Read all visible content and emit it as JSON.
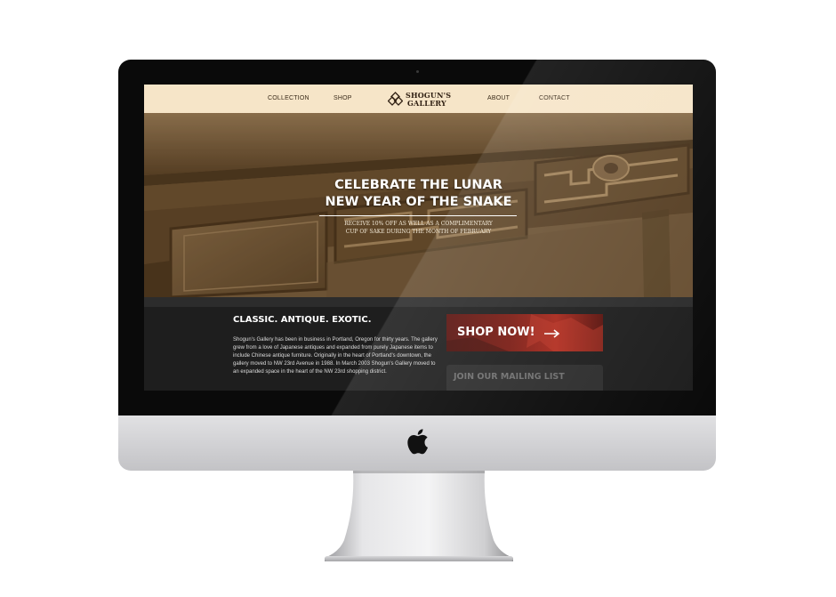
{
  "site": {
    "nav": {
      "left_links": [
        "COLLECTION",
        "SHOP"
      ],
      "right_links": [
        "ABOUT",
        "CONTACT"
      ],
      "brand_line1": "SHOGUN'S",
      "brand_line2": "GALLERY",
      "brand_icon": "diamond-lattice-icon"
    },
    "hero": {
      "title_line1": "CELEBRATE THE LUNAR",
      "title_line2": "NEW YEAR OF THE SNAKE",
      "subtitle_line1": "RECEIVE 10% OFF AS WELL AS A COMPLIMENTARY",
      "subtitle_line2": "CUP OF SAKE DURING THE MONTH OF FEBRUARY"
    },
    "content": {
      "tagline": "CLASSIC. ANTIQUE. EXOTIC.",
      "about": "Shogun's Gallery has been in business in Portland, Oregon for thirty years. The gallery grew from a love of Japanese antiques and expanded from purely Japanese items to include Chinese antique furniture. Originally in the heart of Portland's downtown, the gallery moved to NW 23rd Avenue in 1988. In March 2003 Shogun's Gallery moved to an expanded space in the heart of the NW 23rd shopping district.",
      "shop_button": "SHOP NOW!",
      "mailing_list": "JOIN OUR MAILING LIST"
    }
  },
  "colors": {
    "nav_bg": "#f6e5c8",
    "content_bg": "#1e1e1e",
    "shop_button": "#8b2118",
    "hero_tone": "#6b5233"
  },
  "device": {
    "icon": "apple-icon"
  }
}
